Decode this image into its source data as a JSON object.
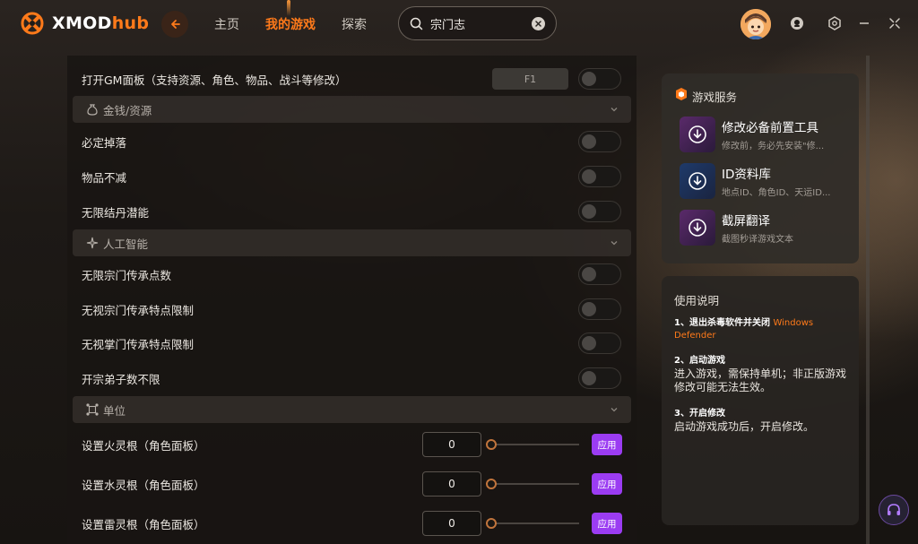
{
  "app": {
    "logo_text_main": "XMOD",
    "logo_text_accent": "hub",
    "accent_color": "#ff7a1a"
  },
  "nav": {
    "home": "主页",
    "my_games": "我的游戏",
    "explore": "探索"
  },
  "search": {
    "value": "宗门志"
  },
  "hotkey_row": {
    "label": "打开GM面板（支持资源、角色、物品、战斗等修改）",
    "key": "F1"
  },
  "sections": [
    {
      "title": "金钱/资源",
      "icon": "money-bag-icon",
      "items": [
        {
          "label": "必定掉落",
          "on": false
        },
        {
          "label": "物品不减",
          "on": false
        },
        {
          "label": "无限结丹潜能",
          "on": false
        }
      ]
    },
    {
      "title": "人工智能",
      "icon": "ai-sparkle-icon",
      "items": [
        {
          "label": "无限宗门传承点数",
          "on": false
        },
        {
          "label": "无视宗门传承特点限制",
          "on": false
        },
        {
          "label": "无视掌门传承特点限制",
          "on": false
        },
        {
          "label": "开宗弟子数不限",
          "on": false
        }
      ]
    },
    {
      "title": "单位",
      "icon": "unit-nodes-icon",
      "items": [
        {
          "label": "设置火灵根（角色面板）",
          "value": "0",
          "apply": "应用"
        },
        {
          "label": "设置水灵根（角色面板）",
          "value": "0",
          "apply": "应用"
        },
        {
          "label": "设置雷灵根（角色面板）",
          "value": "0",
          "apply": "应用"
        }
      ]
    }
  ],
  "services": {
    "title": "游戏服务",
    "items": [
      {
        "name": "修改必备前置工具",
        "desc": "修改前，务必先安装\"修...",
        "icon": "download-icon"
      },
      {
        "name": "ID资料库",
        "desc": "地点ID、角色ID、天运ID...",
        "icon": "download-icon"
      },
      {
        "name": "截屏翻译",
        "desc": "截图秒译游戏文本",
        "icon": "download-icon"
      }
    ]
  },
  "help": {
    "title": "使用说明",
    "steps": [
      {
        "head": "1、退出杀毒软件并关闭",
        "link": "Windows Defender",
        "body": ""
      },
      {
        "head": "2、启动游戏",
        "link": "",
        "body": "进入游戏，需保持单机；非正版游戏修改可能无法生效。"
      },
      {
        "head": "3、开启修改",
        "link": "",
        "body": "启动游戏成功后，开启修改。"
      }
    ]
  }
}
